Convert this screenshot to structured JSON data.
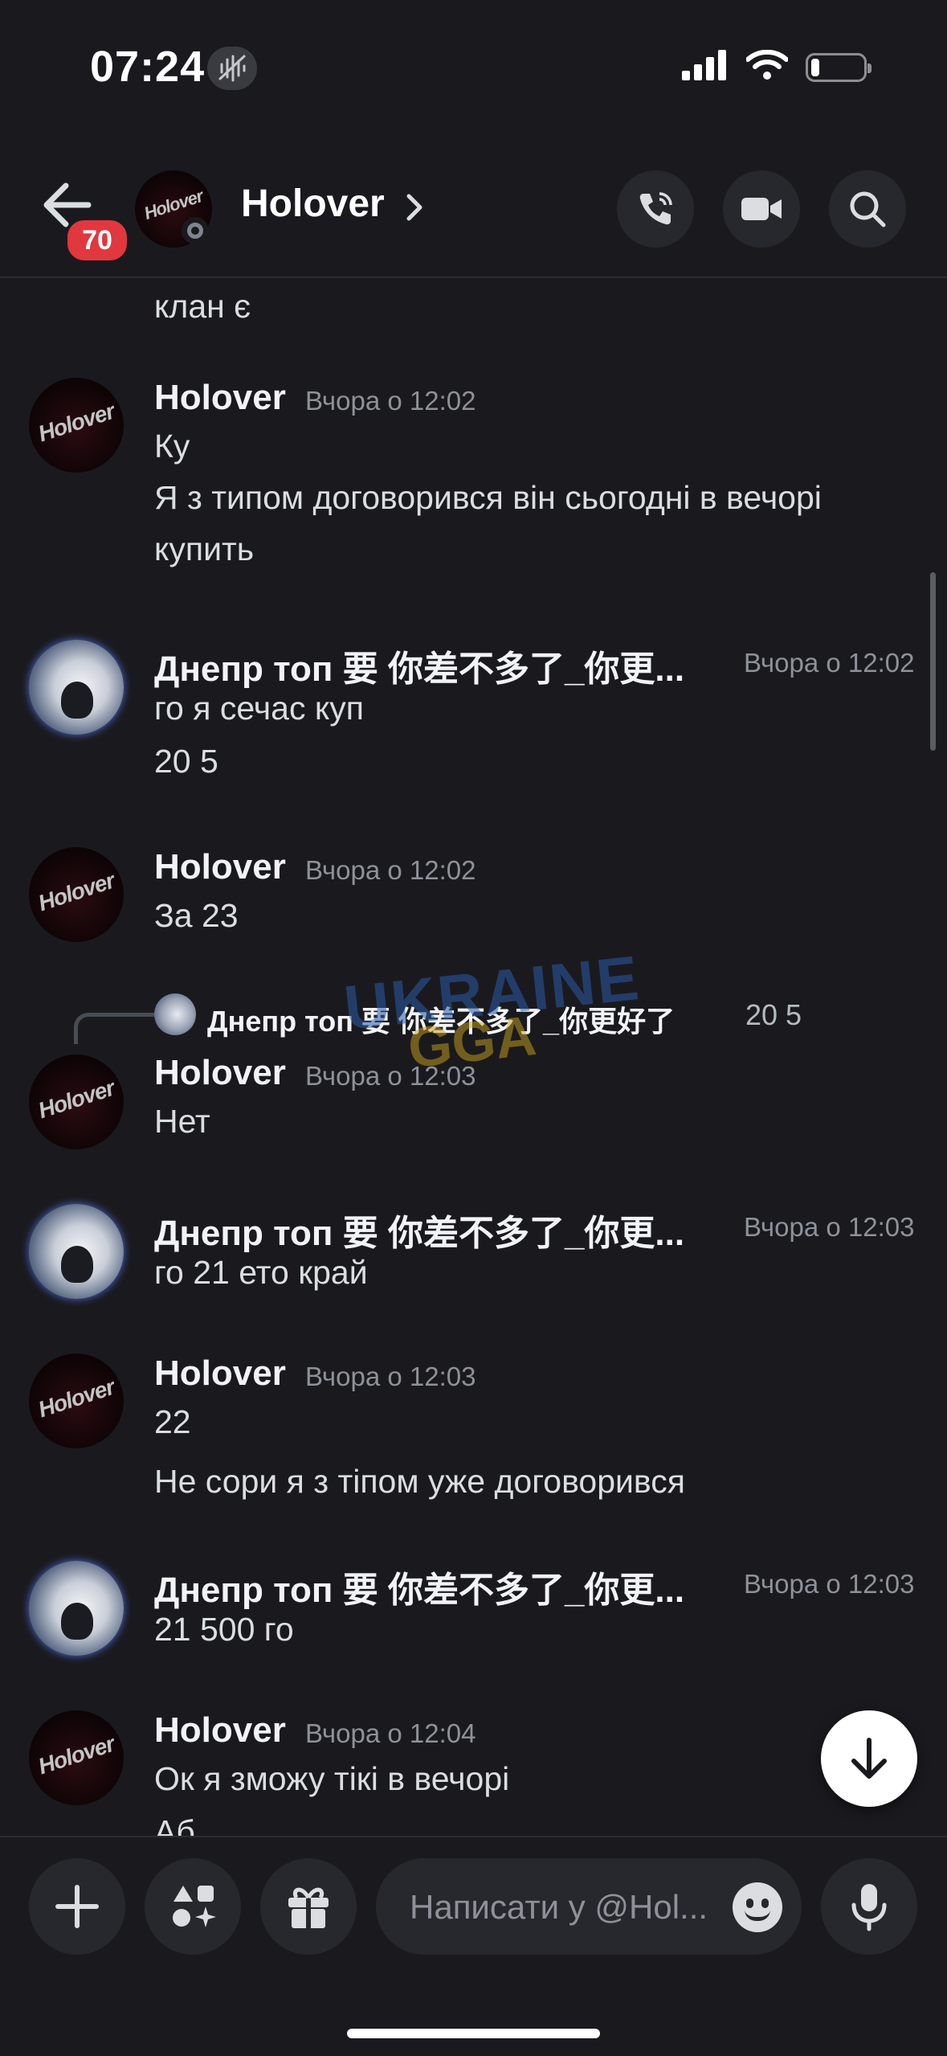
{
  "status_bar": {
    "time": "07:24"
  },
  "header": {
    "unread_badge": "70",
    "title": "Holover"
  },
  "messages": [
    {
      "type": "continuation",
      "lines": [
        "клан є"
      ]
    },
    {
      "user": "Holover",
      "timestamp": "Вчора о 12:02",
      "lines": [
        "Ку",
        "Я з типом договорився він сьогодні в вечорі",
        "купить"
      ]
    },
    {
      "user": "Днепр топ 要 你差不多了_你更...",
      "timestamp": "Вчора о 12:02",
      "lines": [
        "го я сечас куп",
        "20 5"
      ]
    },
    {
      "user": "Holover",
      "timestamp": "Вчора о 12:02",
      "lines": [
        "За 23"
      ]
    },
    {
      "reply": {
        "user": "Днепр топ 要 你差不多了_你更好了",
        "text": "20 5"
      },
      "user": "Holover",
      "timestamp": "Вчора о 12:03",
      "lines": [
        "Нет"
      ]
    },
    {
      "user": "Днепр топ 要 你差不多了_你更...",
      "timestamp": "Вчора о 12:03",
      "lines": [
        "го 21 ето край"
      ]
    },
    {
      "user": "Holover",
      "timestamp": "Вчора о 12:03",
      "lines": [
        "22",
        "Не сори я з тіпом уже договорився"
      ]
    },
    {
      "user": "Днепр топ 要 你差不多了_你更...",
      "timestamp": "Вчора о 12:03",
      "lines": [
        "21 500 го"
      ]
    },
    {
      "user": "Holover",
      "timestamp": "Вчора о 12:04",
      "lines": [
        "Ок я зможу тікі в вечорі",
        "Аб..."
      ]
    }
  ],
  "avatar_text": "Holover",
  "watermark": {
    "line1": "UKRAINE",
    "line2": "GGA"
  },
  "composer": {
    "placeholder": "Написати у @Hol..."
  },
  "icons": {
    "back": "arrow-left-icon",
    "chevron": "chevron-right-icon",
    "call": "phone-icon",
    "video": "video-camera-icon",
    "search": "search-icon",
    "plus": "plus-icon",
    "apps": "apps-icon",
    "gift": "gift-icon",
    "emoji": "emoji-icon",
    "mic": "microphone-icon",
    "jump": "arrow-down-icon"
  },
  "colors": {
    "background": "#1a1a1e",
    "badge": "#e0383e",
    "surface": "#27282d",
    "muted_text": "#8e9199"
  }
}
